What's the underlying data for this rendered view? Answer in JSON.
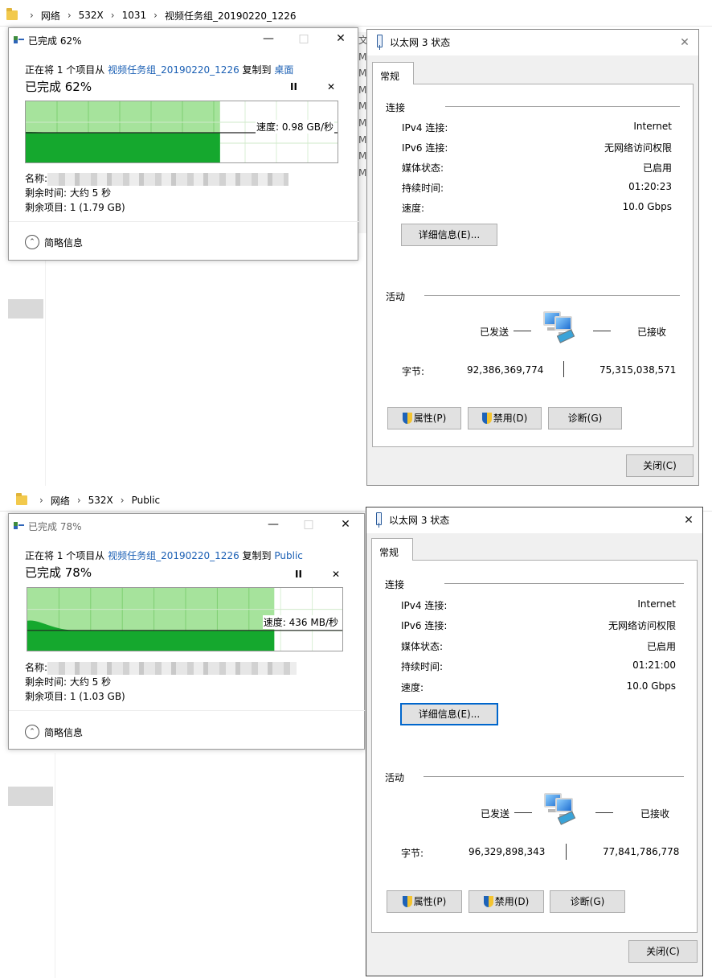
{
  "panel1": {
    "breadcrumb": [
      "网络",
      "532X",
      "1031",
      "视频任务组_20190220_1226"
    ],
    "explorer_col": [
      "文",
      "M",
      "M",
      "M",
      "M",
      "M",
      "M",
      "M",
      "M"
    ],
    "copy": {
      "title": "已完成 62%",
      "line_prefix": "正在将 1 个项目从 ",
      "source": "视频任务组_20190220_1226",
      "line_mid": " 复制到 ",
      "dest": "桌面",
      "big_status": "已完成 62%",
      "pause": "II",
      "cancel": "✕",
      "progress": 0.62,
      "speed": "速度: 0.98 GB/秒",
      "name_label": "名称:",
      "time_left": "剩余时间: 大约 5 秒",
      "items_left": "剩余项目: 1 (1.79 GB)",
      "brief": "简略信息",
      "min": "—",
      "max": "□",
      "close": "✕"
    },
    "eth": {
      "title": "以太网 3 状态",
      "close": "✕",
      "tab": "常规",
      "sec_conn": "连接",
      "rows": [
        {
          "label": "IPv4 连接:",
          "value": "Internet"
        },
        {
          "label": "IPv6 连接:",
          "value": "无网络访问权限"
        },
        {
          "label": "媒体状态:",
          "value": "已启用"
        },
        {
          "label": "持续时间:",
          "value": "01:20:23"
        },
        {
          "label": "速度:",
          "value": "10.0 Gbps"
        }
      ],
      "details_btn": "详细信息(E)...",
      "sec_act": "活动",
      "sent": "已发送",
      "recv": "已接收",
      "bytes_label": "字节:",
      "bytes_sent": "92,386,369,774",
      "bytes_recv": "75,315,038,571",
      "btn_props": "属性(P)",
      "btn_disable": "禁用(D)",
      "btn_diag": "诊断(G)",
      "btn_close": "关闭(C)"
    }
  },
  "panel2": {
    "breadcrumb": [
      "网络",
      "532X",
      "Public"
    ],
    "copy": {
      "title": "已完成 78%",
      "line_prefix": "正在将 1 个项目从 ",
      "source": "视频任务组_20190220_1226",
      "line_mid": " 复制到 ",
      "dest": "Public",
      "big_status": "已完成 78%",
      "pause": "II",
      "cancel": "✕",
      "progress": 0.78,
      "speed": "速度: 436 MB/秒",
      "name_label": "名称:",
      "time_left": "剩余时间: 大约 5 秒",
      "items_left": "剩余项目: 1 (1.03 GB)",
      "brief": "简略信息",
      "min": "—",
      "max": "□",
      "close": "✕"
    },
    "eth": {
      "title": "以太网 3 状态",
      "close": "✕",
      "tab": "常规",
      "sec_conn": "连接",
      "rows": [
        {
          "label": "IPv4 连接:",
          "value": "Internet"
        },
        {
          "label": "IPv6 连接:",
          "value": "无网络访问权限"
        },
        {
          "label": "媒体状态:",
          "value": "已启用"
        },
        {
          "label": "持续时间:",
          "value": "01:21:00"
        },
        {
          "label": "速度:",
          "value": "10.0 Gbps"
        }
      ],
      "details_btn": "详细信息(E)...",
      "sec_act": "活动",
      "sent": "已发送",
      "recv": "已接收",
      "bytes_label": "字节:",
      "bytes_sent": "96,329,898,343",
      "bytes_recv": "77,841,786,778",
      "btn_props": "属性(P)",
      "btn_disable": "禁用(D)",
      "btn_diag": "诊断(G)",
      "btn_close": "关闭(C)"
    }
  }
}
